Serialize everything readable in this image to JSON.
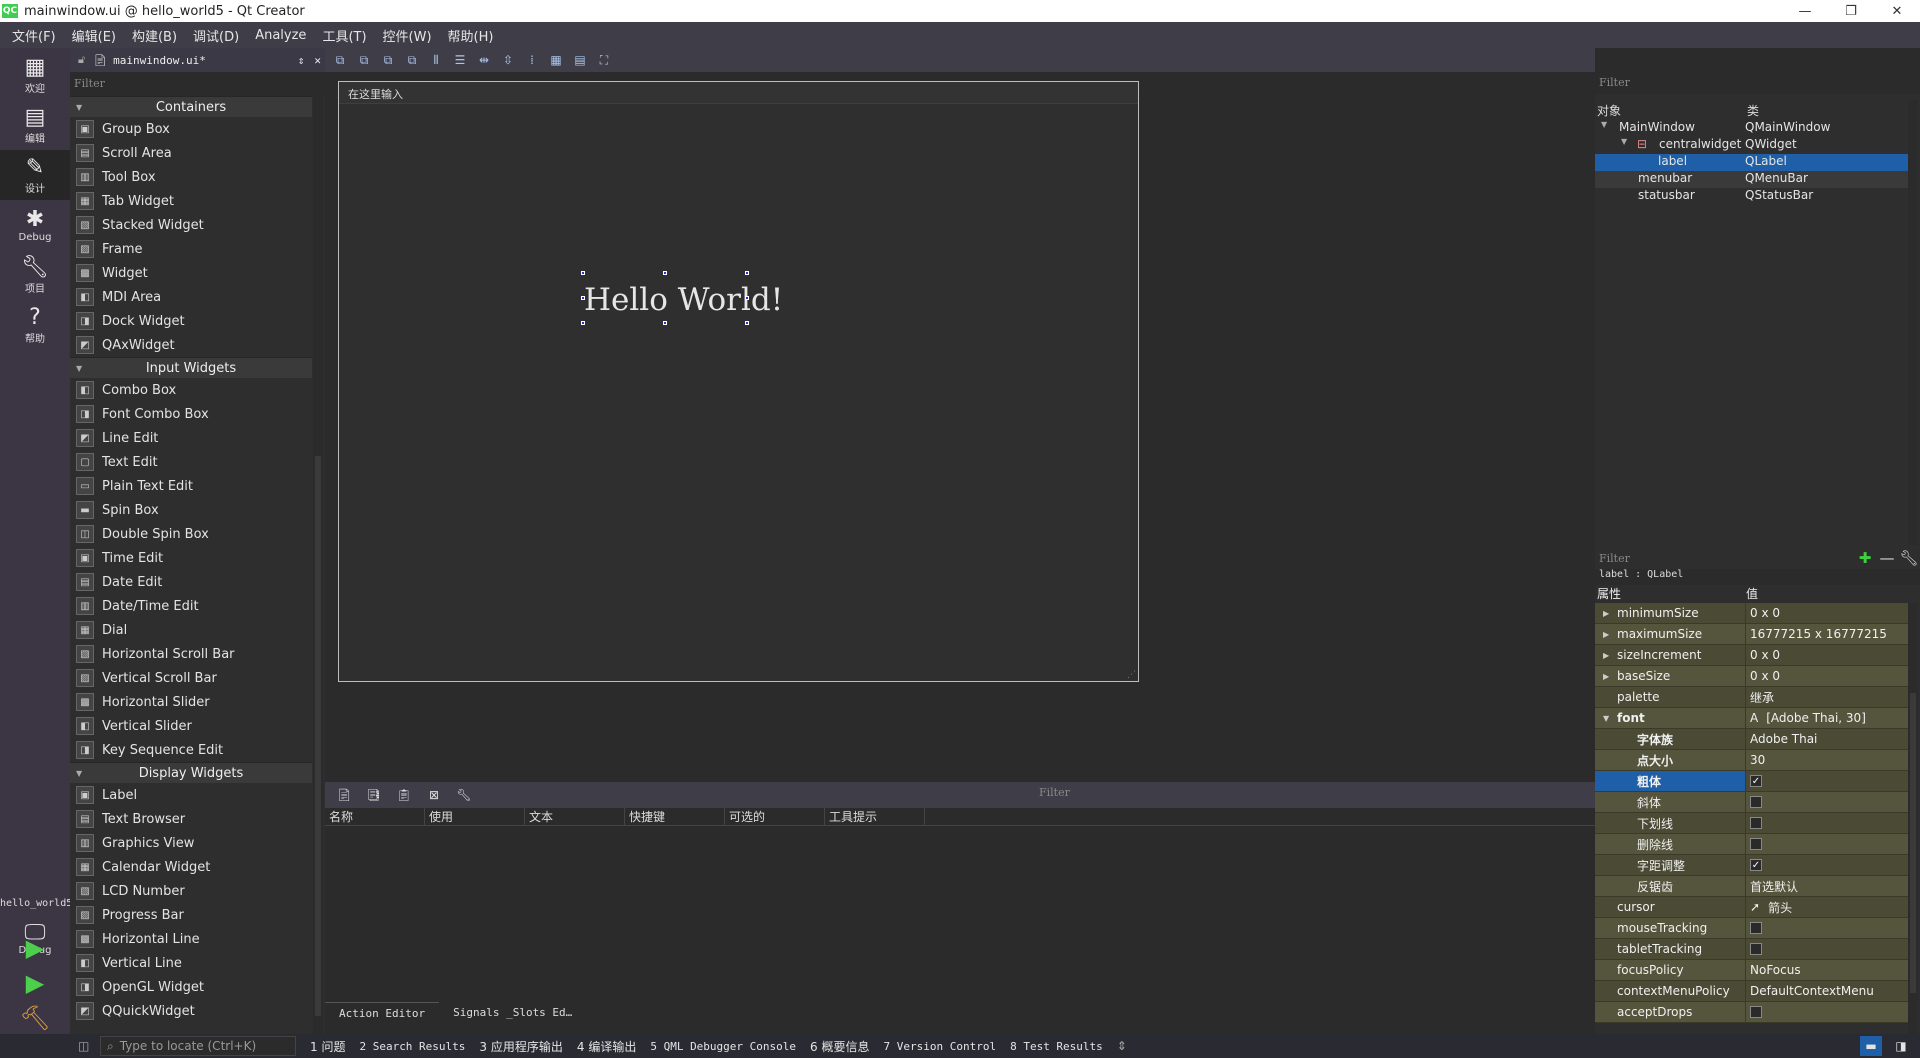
{
  "window": {
    "title": "mainwindow.ui @ hello_world5 - Qt Creator",
    "logo": "QC",
    "controls": [
      "minimize-icon",
      "restore-icon",
      "close-icon"
    ]
  },
  "menubar": {
    "items": [
      "文件(F)",
      "编辑(E)",
      "构建(B)",
      "调试(D)",
      "Analyze",
      "工具(T)",
      "控件(W)",
      "帮助(H)"
    ]
  },
  "modes": [
    {
      "label": "欢迎",
      "icon": "grid-icon"
    },
    {
      "label": "编辑",
      "icon": "edit-doc-icon"
    },
    {
      "label": "设计",
      "icon": "pencil-icon"
    },
    {
      "label": "Debug",
      "icon": "bug-icon"
    },
    {
      "label": "项目",
      "icon": "wrench-icon"
    },
    {
      "label": "帮助",
      "icon": "help-icon"
    }
  ],
  "kit": {
    "project": "hello_world5",
    "build": "Debug"
  },
  "doc": {
    "filename": "mainwindow.ui*"
  },
  "widgetbox": {
    "filter_placeholder": "Filter",
    "categories": [
      {
        "name": "Containers",
        "items": [
          "Group Box",
          "Scroll Area",
          "Tool Box",
          "Tab Widget",
          "Stacked Widget",
          "Frame",
          "Widget",
          "MDI Area",
          "Dock Widget",
          "QAxWidget"
        ]
      },
      {
        "name": "Input Widgets",
        "items": [
          "Combo Box",
          "Font Combo Box",
          "Line Edit",
          "Text Edit",
          "Plain Text Edit",
          "Spin Box",
          "Double Spin Box",
          "Time Edit",
          "Date Edit",
          "Date/Time Edit",
          "Dial",
          "Horizontal Scroll Bar",
          "Vertical Scroll Bar",
          "Horizontal Slider",
          "Vertical Slider",
          "Key Sequence Edit"
        ]
      },
      {
        "name": "Display Widgets",
        "items": [
          "Label",
          "Text Browser",
          "Graphics View",
          "Calendar Widget",
          "LCD Number",
          "Progress Bar",
          "Horizontal Line",
          "Vertical Line",
          "OpenGL Widget",
          "QQuickWidget"
        ]
      }
    ]
  },
  "form": {
    "menu_placeholder": "在这里输入",
    "label_text": "Hello World!"
  },
  "action_editor": {
    "filter_placeholder": "Filter",
    "columns": [
      "名称",
      "使用",
      "文本",
      "快捷键",
      "可选的",
      "工具提示"
    ],
    "tabs": [
      "Action Editor",
      "Signals _Slots Ed…"
    ]
  },
  "object_inspector": {
    "filter_placeholder": "Filter",
    "columns": [
      "对象",
      "类"
    ],
    "rows": [
      {
        "object": "MainWindow",
        "class": "QMainWindow"
      },
      {
        "object": "centralwidget",
        "class": "QWidget"
      },
      {
        "object": "label",
        "class": "QLabel"
      },
      {
        "object": "menubar",
        "class": "QMenuBar"
      },
      {
        "object": "statusbar",
        "class": "QStatusBar"
      }
    ]
  },
  "property_editor": {
    "filter_placeholder": "Filter",
    "class_line": "label : QLabel",
    "columns": [
      "属性",
      "值"
    ],
    "rows": [
      {
        "key": "minimumSize",
        "value": "0 x 0"
      },
      {
        "key": "maximumSize",
        "value": "16777215 x 16777215"
      },
      {
        "key": "sizeIncrement",
        "value": "0 x 0"
      },
      {
        "key": "baseSize",
        "value": "0 x 0"
      },
      {
        "key": "palette",
        "value": "继承"
      },
      {
        "key": "font",
        "value": "[Adobe Thai, 30]"
      },
      {
        "key": "字体族",
        "value": "Adobe Thai"
      },
      {
        "key": "点大小",
        "value": "30"
      },
      {
        "key": "粗体",
        "value": "✓"
      },
      {
        "key": "斜体",
        "value": ""
      },
      {
        "key": "下划线",
        "value": ""
      },
      {
        "key": "删除线",
        "value": ""
      },
      {
        "key": "字距调整",
        "value": "✓"
      },
      {
        "key": "反锯齿",
        "value": "首选默认"
      },
      {
        "key": "cursor",
        "value": "箭头"
      },
      {
        "key": "mouseTracking",
        "value": ""
      },
      {
        "key": "tabletTracking",
        "value": ""
      },
      {
        "key": "focusPolicy",
        "value": "NoFocus"
      },
      {
        "key": "contextMenuPolicy",
        "value": "DefaultContextMenu"
      },
      {
        "key": "acceptDrops",
        "value": ""
      }
    ]
  },
  "statusbar": {
    "locator_placeholder": "Type to locate (Ctrl+K)",
    "panes": [
      "1 问题",
      "2 Search Results",
      "3 应用程序输出",
      "4 编译输出",
      "5 QML Debugger Console",
      "6 概要信息",
      "7 Version Control",
      "8 Test Results"
    ]
  },
  "colors": {
    "selection": "#1f5fa8",
    "menubar": "#3f3d48",
    "modebar": "#3c3644",
    "property_row": "#4a4a35"
  }
}
